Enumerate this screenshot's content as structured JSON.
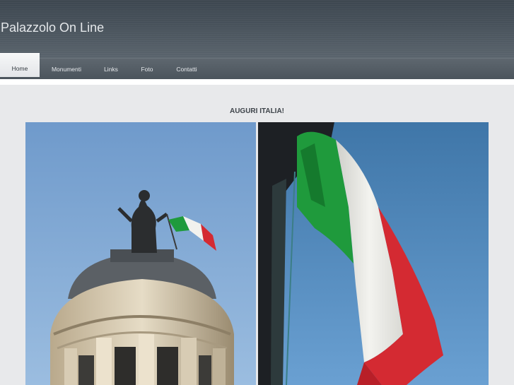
{
  "site": {
    "title": "Palazzolo On Line"
  },
  "nav": {
    "items": [
      {
        "label": "Home",
        "active": true
      },
      {
        "label": "Monumenti",
        "active": false
      },
      {
        "label": "Links",
        "active": false
      },
      {
        "label": "Foto",
        "active": false
      },
      {
        "label": "Contatti",
        "active": false
      }
    ]
  },
  "main": {
    "headline": "AUGURI ITALIA!"
  },
  "colors": {
    "header": "#48525b",
    "nav": "#525b63",
    "content_bg": "#e8e9eb",
    "flag_green": "#1f9a3c",
    "flag_white": "#f2f2ee",
    "flag_red": "#d42a32",
    "sky": "#5f8fbe"
  }
}
